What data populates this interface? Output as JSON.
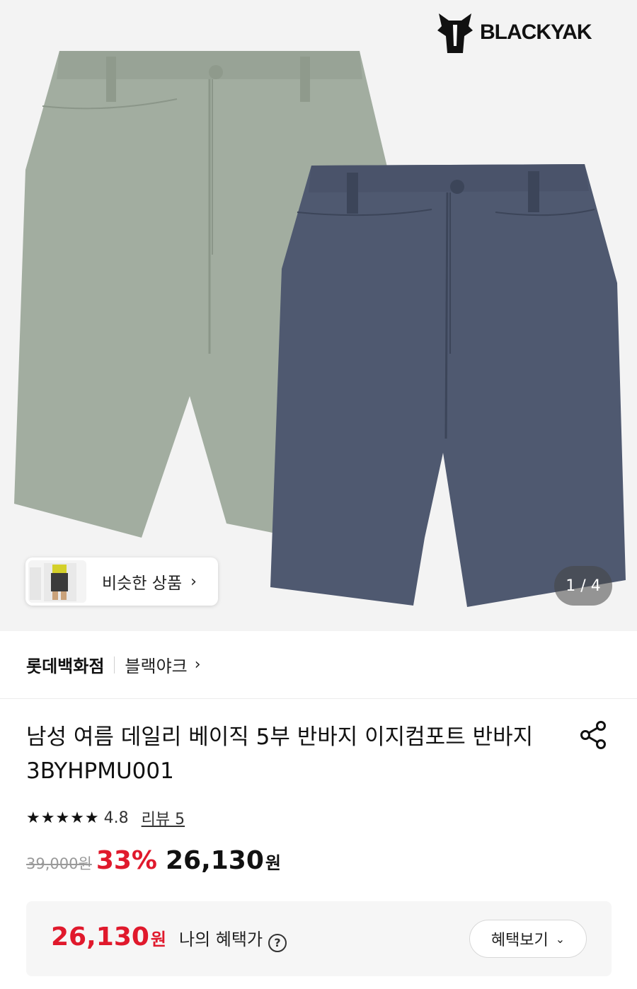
{
  "brand_logo": {
    "text": "BLACKYAK",
    "icon": "yak-logo-icon"
  },
  "similar": {
    "label": "비슷한 상품",
    "chevron": "›"
  },
  "pager": {
    "text": "1 / 4"
  },
  "store": {
    "name": "롯데백화점",
    "brand": "블랙야크",
    "chevron": "›"
  },
  "product": {
    "title": "남성 여름 데일리 베이직 5부 반바지 이지컴포트 반바지 3BYHPMU001",
    "rating_stars": "★★★★★",
    "rating_value": "4.8",
    "review_link": "리뷰 5",
    "original_price": "39,000원",
    "discount": "33%",
    "final_price": "26,130",
    "final_currency": "원"
  },
  "benefit": {
    "price": "26,130",
    "currency": "원",
    "label": "나의 혜택가",
    "help_icon": "?",
    "button_label": "혜택보기",
    "button_chevron": "⌄"
  },
  "colors": {
    "discount_red": "#e0192c",
    "pants_green": "#a2ada0",
    "pants_navy": "#4f5970"
  }
}
